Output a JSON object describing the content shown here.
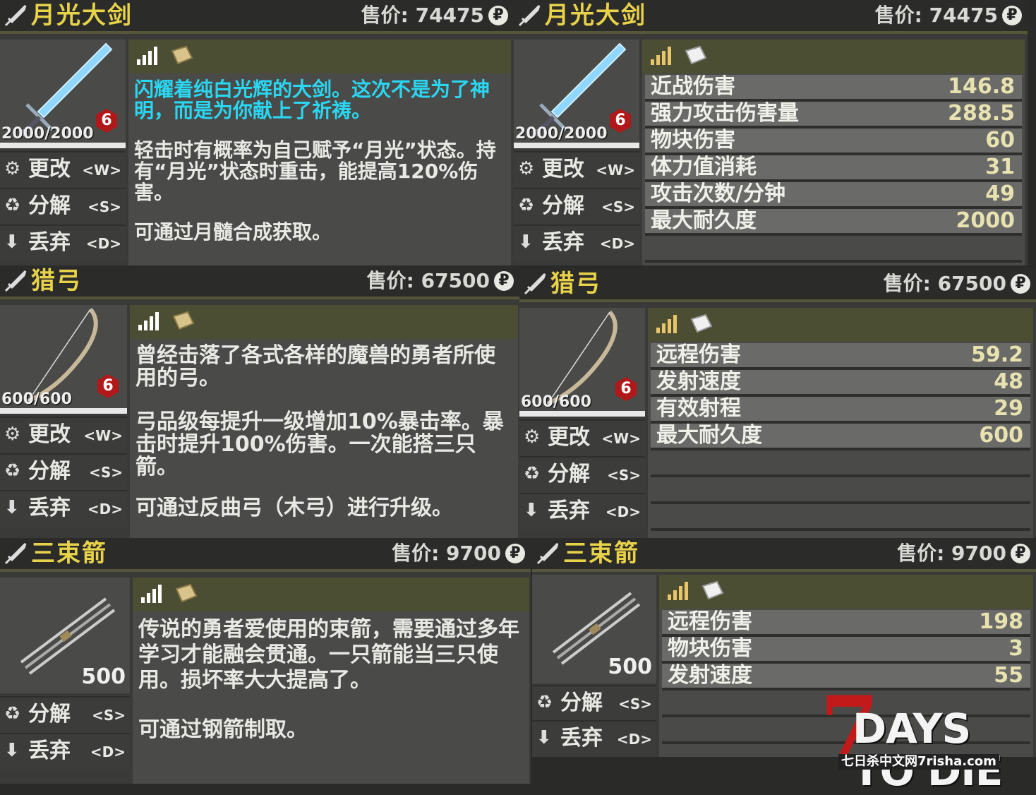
{
  "panels": [
    {
      "title": "月光大剑",
      "price_label": "售价: 74475",
      "currency_icon": "ruble-coin-icon",
      "durability": "2000/2000",
      "tier": "6",
      "actions": [
        {
          "label": "更改",
          "key": "<W>",
          "icon": "gears-icon"
        },
        {
          "label": "分解",
          "key": "<S>",
          "icon": "recycle-icon"
        },
        {
          "label": "丢弃",
          "key": "<D>",
          "icon": "arrow-down-icon"
        }
      ],
      "desc_highlight": "闪耀着纯白光辉的大剑。这次不是为了神明，而是为你献上了祈祷。",
      "desc_lines": [
        "轻击时有概率为自己赋予“月光”状态。持有“月光”状态时重击，能提高120%伤害。",
        "可通过月髓合成获取。"
      ]
    },
    {
      "title": "月光大剑",
      "price_label": "售价: 74475",
      "currency_icon": "ruble-coin-icon",
      "durability": "2000/2000",
      "tier": "6",
      "actions": [
        {
          "label": "更改",
          "key": "<W>",
          "icon": "gears-icon"
        },
        {
          "label": "分解",
          "key": "<S>",
          "icon": "recycle-icon"
        },
        {
          "label": "丢弃",
          "key": "<D>",
          "icon": "arrow-down-icon"
        }
      ],
      "stats": [
        {
          "label": "近战伤害",
          "value": "146.8"
        },
        {
          "label": "强力攻击伤害量",
          "value": "288.5"
        },
        {
          "label": "物块伤害",
          "value": "60"
        },
        {
          "label": "体力值消耗",
          "value": "31"
        },
        {
          "label": "攻击次数/分钟",
          "value": "49"
        },
        {
          "label": "最大耐久度",
          "value": "2000"
        }
      ]
    },
    {
      "title": "猎弓",
      "price_label": "售价: 67500",
      "currency_icon": "ruble-coin-icon",
      "durability": "600/600",
      "tier": "6",
      "actions": [
        {
          "label": "更改",
          "key": "<W>",
          "icon": "gears-icon"
        },
        {
          "label": "分解",
          "key": "<S>",
          "icon": "recycle-icon"
        },
        {
          "label": "丢弃",
          "key": "<D>",
          "icon": "arrow-down-icon"
        }
      ],
      "desc_lines": [
        "曾经击落了各式各样的魔兽的勇者所使用的弓。",
        "弓品级每提升一级增加10%暴击率。暴击时提升100%伤害。一次能搭三只箭。",
        "可通过反曲弓（木弓）进行升级。"
      ]
    },
    {
      "title": "猎弓",
      "price_label": "售价: 67500",
      "currency_icon": "ruble-coin-icon",
      "durability": "600/600",
      "tier": "6",
      "actions": [
        {
          "label": "更改",
          "key": "<W>",
          "icon": "gears-icon"
        },
        {
          "label": "分解",
          "key": "<S>",
          "icon": "recycle-icon"
        },
        {
          "label": "丢弃",
          "key": "<D>",
          "icon": "arrow-down-icon"
        }
      ],
      "stats": [
        {
          "label": "远程伤害",
          "value": "59.2"
        },
        {
          "label": "发射速度",
          "value": "48"
        },
        {
          "label": "有效射程",
          "value": "29"
        },
        {
          "label": "最大耐久度",
          "value": "600"
        }
      ]
    },
    {
      "title": "三束箭",
      "price_label": "售价: 9700",
      "currency_icon": "ruble-coin-icon",
      "count": "500",
      "actions": [
        {
          "label": "分解",
          "key": "<S>",
          "icon": "recycle-icon"
        },
        {
          "label": "丢弃",
          "key": "<D>",
          "icon": "arrow-down-icon"
        }
      ],
      "desc_lines": [
        "传说的勇者爱使用的束箭，需要通过多年学习才能融会贯通。一只箭能当三只使用。损坏率大大提高了。",
        "可通过钢箭制取。"
      ]
    },
    {
      "title": "三束箭",
      "price_label": "售价: 9700",
      "currency_icon": "ruble-coin-icon",
      "count": "500",
      "actions": [
        {
          "label": "分解",
          "key": "<S>",
          "icon": "recycle-icon"
        },
        {
          "label": "丢弃",
          "key": "<D>",
          "icon": "arrow-down-icon"
        }
      ],
      "stats": [
        {
          "label": "远程伤害",
          "value": "198"
        },
        {
          "label": "物块伤害",
          "value": "3"
        },
        {
          "label": "发射速度",
          "value": "55"
        }
      ]
    }
  ],
  "watermark": {
    "seven": "7",
    "title": "DAYS TO DIE",
    "subtitle": "七日杀中文网7risha.com"
  },
  "colors": {
    "title_yellow": "#e8d24a",
    "highlight_cyan": "#2ad7f2",
    "tier_red": "#b0181a",
    "header_olive": "#4b4e32"
  }
}
